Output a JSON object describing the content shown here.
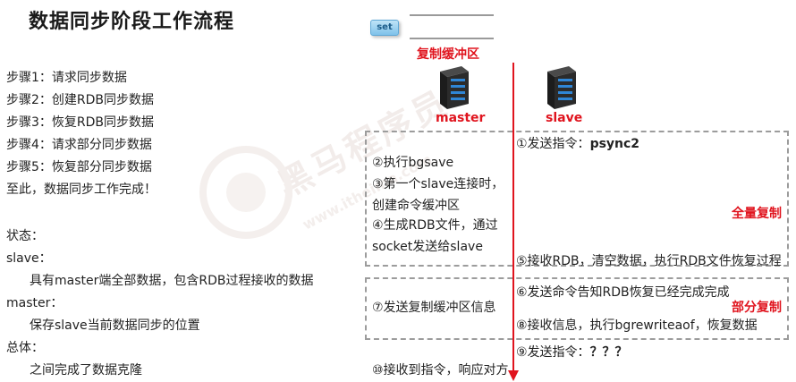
{
  "title": "数据同步阶段工作流程",
  "steps": [
    "步骤1：请求同步数据",
    "步骤2：创建RDB同步数据",
    "步骤3：恢复RDB同步数据",
    "步骤4：请求部分同步数据",
    "步骤5：恢复部分同步数据",
    "至此，数据同步工作完成！"
  ],
  "status": {
    "heading": "状态：",
    "slave_label": "slave：",
    "slave_desc": "具有master端全部数据，包含RDB过程接收的数据",
    "master_label": "master：",
    "master_desc": "保存slave当前数据同步的位置",
    "overall_label": "总体：",
    "overall_desc": "之间完成了数据克隆"
  },
  "diagram": {
    "set_button": "set",
    "buffer_label": "复制缓冲区",
    "master_label": "master",
    "slave_label": "slave",
    "full_sync_label": "全量复制",
    "partial_sync_label": "部分复制",
    "step1": "①发送指令：",
    "step1_cmd": "psync2",
    "step2": "②执行bgsave",
    "step3_line1": "③第一个slave连接时，",
    "step3_line2": "创建命令缓冲区",
    "step4_line1": "④生成RDB文件，通过",
    "step4_line2": "socket发送给slave",
    "step5": "⑤接收RDB，清空数据，执行RDB文件恢复过程",
    "step6": "⑥发送命令告知RDB恢复已经完成完成",
    "step7": "⑦发送复制缓冲区信息",
    "step8": "⑧接收信息，执行bgrewriteaof，恢复数据",
    "step9": "⑨发送指令：",
    "step9_cmd": "？？？",
    "step10": "⑩接收到指令，响应对方"
  },
  "colors": {
    "accent_red": "#e0141e",
    "dashed_border": "#9c9c9c",
    "server_dark": "#2b2b2b",
    "server_blue": "#2f86d6"
  },
  "watermark": {
    "text": "黑马程序员",
    "subtext": "www.itheima.com"
  }
}
